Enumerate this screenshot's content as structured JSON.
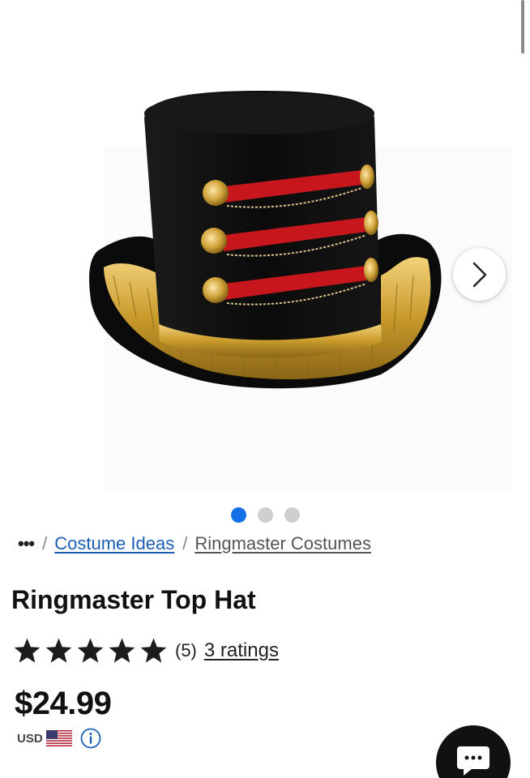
{
  "gallery": {
    "image_alt": "Ringmaster Top Hat",
    "dot_count": 3,
    "active_index": 0,
    "next_icon": "chevron-right-icon"
  },
  "breadcrumb": {
    "more": "•••",
    "separator": "/",
    "items": [
      {
        "label": "Costume Ideas",
        "color": "#1a5fb4"
      },
      {
        "label": "Ringmaster Costumes",
        "color": "#555555"
      }
    ]
  },
  "product": {
    "title": "Ringmaster Top Hat",
    "rating": 5,
    "rating_label": "(5)",
    "ratings_link": "3 ratings",
    "price": "$24.99",
    "currency": "USD",
    "currency_icon": "us-flag-icon",
    "info_icon": "info-icon"
  },
  "chat": {
    "icon": "chat-bubble-icon"
  },
  "colors": {
    "accent_blue": "#1470e6",
    "link_blue": "#1a5fb4",
    "hat_red": "#c8161d",
    "hat_gold": "#c89a2b"
  }
}
